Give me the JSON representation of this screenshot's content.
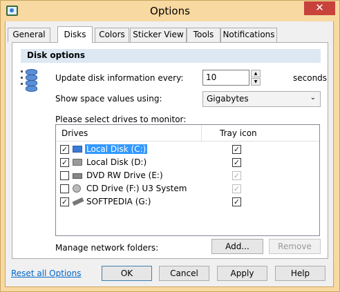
{
  "window": {
    "title": "Options",
    "close_glyph": "✕"
  },
  "tabs": [
    {
      "label": "General"
    },
    {
      "label": "Disks"
    },
    {
      "label": "Colors"
    },
    {
      "label": "Sticker View"
    },
    {
      "label": "Tools"
    },
    {
      "label": "Notifications"
    }
  ],
  "active_tab": "Disks",
  "disk_options": {
    "header": "Disk options",
    "update_label": "Update disk information every:",
    "update_value": "10",
    "update_unit": "seconds",
    "space_label": "Show space values using:",
    "space_value": "Gigabytes",
    "drives_prompt": "Please select drives to monitor:"
  },
  "drive_list": {
    "col_drives": "Drives",
    "col_tray": "Tray icon",
    "rows": [
      {
        "name": "Local Disk (C:)",
        "checked": true,
        "tray": true,
        "tray_disabled": false,
        "icon": "windows-drive-icon",
        "selected": true
      },
      {
        "name": "Local Disk (D:)",
        "checked": true,
        "tray": true,
        "tray_disabled": false,
        "icon": "hard-drive-icon",
        "selected": false
      },
      {
        "name": "DVD RW Drive (E:)",
        "checked": false,
        "tray": true,
        "tray_disabled": true,
        "icon": "dvd-drive-icon",
        "selected": false
      },
      {
        "name": "CD Drive (F:) U3 System",
        "checked": false,
        "tray": true,
        "tray_disabled": true,
        "icon": "cd-drive-icon",
        "selected": false
      },
      {
        "name": "SOFTPEDIA (G:)",
        "checked": true,
        "tray": true,
        "tray_disabled": false,
        "icon": "usb-drive-icon",
        "selected": false
      }
    ]
  },
  "network": {
    "label": "Manage network folders:",
    "add_label": "Add...",
    "remove_label": "Remove"
  },
  "footer": {
    "reset_link": "Reset all Options",
    "ok_label": "OK",
    "cancel_label": "Cancel",
    "apply_label": "Apply",
    "help_label": "Help"
  },
  "glyphs": {
    "check": "✓",
    "spin_up": "▲",
    "spin_down": "▼",
    "chevron": "⌄"
  },
  "colors": {
    "titlebar": "#f7d9a1",
    "section_header": "#dde8f3",
    "selection": "#3399ff",
    "link": "#0066cc",
    "close": "#c7423a"
  }
}
